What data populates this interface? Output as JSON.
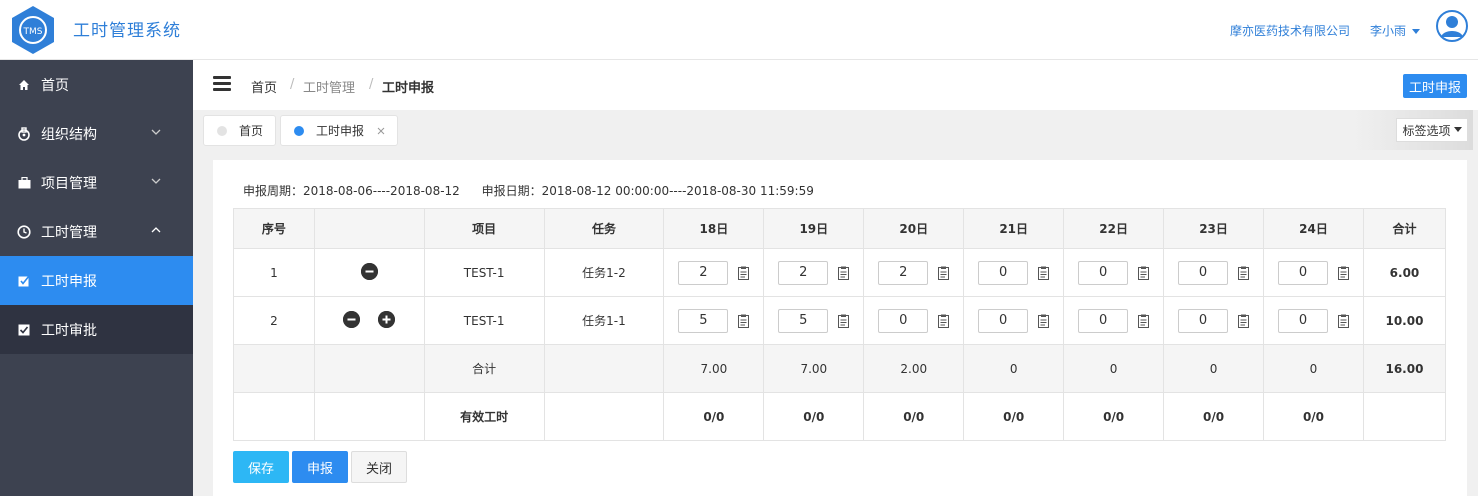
{
  "header": {
    "logo_text": "TMS",
    "app_title": "工时管理系统",
    "company": "摩亦医药技术有限公司",
    "user": "李小雨",
    "accent": "#2f7fd8"
  },
  "sidebar": {
    "items": [
      {
        "label": "首页",
        "icon": "home-icon"
      },
      {
        "label": "组织结构",
        "icon": "lock-icon"
      },
      {
        "label": "项目管理",
        "icon": "briefcase-icon"
      },
      {
        "label": "工时管理",
        "icon": "clock-icon"
      },
      {
        "label": "工时申报",
        "icon": "edit-checkbox-icon"
      },
      {
        "label": "工时审批",
        "icon": "checkbox-icon"
      }
    ]
  },
  "breadcrumb": [
    "首页",
    "工时管理",
    "工时申报"
  ],
  "top_button": "工时申报",
  "tabs": [
    {
      "label": "首页",
      "active": false
    },
    {
      "label": "工时申报",
      "active": true
    }
  ],
  "tab_options": "标签选项",
  "period": {
    "text": "申报周期：2018-08-06----2018-08-12",
    "date_text": "申报日期：2018-08-12 00:00:00----2018-08-30 11:59:59"
  },
  "table": {
    "headers": [
      "序号",
      "",
      "项目",
      "任务",
      "18日",
      "19日",
      "20日",
      "21日",
      "22日",
      "23日",
      "24日",
      "合计"
    ],
    "rows": [
      {
        "no": "1",
        "project": "TEST-1",
        "task": "任务1-2",
        "hours": [
          "2",
          "2",
          "2",
          "0",
          "0",
          "0",
          "0"
        ],
        "total": "6.00"
      },
      {
        "no": "2",
        "project": "TEST-1",
        "task": "任务1-1",
        "hours": [
          "5",
          "5",
          "0",
          "0",
          "0",
          "0",
          "0"
        ],
        "total": "10.00"
      }
    ],
    "sum_label": "合计",
    "sums": [
      "7.00",
      "7.00",
      "2.00",
      "0",
      "0",
      "0",
      "0"
    ],
    "sum_total": "16.00",
    "effective_label": "有效工时",
    "effective": [
      "0/0",
      "0/0",
      "0/0",
      "0/0",
      "0/0",
      "0/0",
      "0/0"
    ]
  },
  "actions": {
    "save": "保存",
    "submit": "申报",
    "close": "关闭"
  }
}
